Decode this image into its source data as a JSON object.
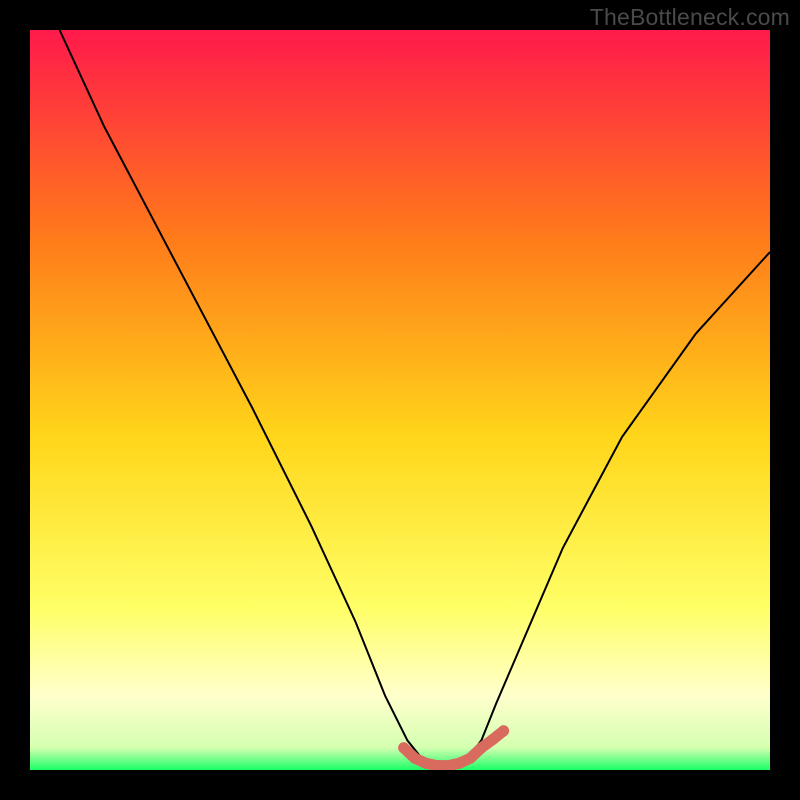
{
  "watermark": "TheBottleneck.com",
  "colors": {
    "frame_bg": "#000000",
    "gradient_top": "#ff1a4b",
    "gradient_mid1": "#ff7a1a",
    "gradient_mid2": "#ffd61a",
    "gradient_low": "#ffff66",
    "gradient_near_bottom": "#ffffcc",
    "gradient_bottom": "#1aff66",
    "curve": "#000000",
    "marker": "#d86a5e"
  },
  "chart_data": {
    "type": "line",
    "title": "",
    "xlabel": "",
    "ylabel": "",
    "xlim": [
      0,
      100
    ],
    "ylim": [
      0,
      100
    ],
    "series": [
      {
        "name": "bottleneck-curve",
        "x": [
          4,
          10,
          20,
          30,
          38,
          44,
          48,
          51,
          53,
          55,
          57,
          59,
          61,
          63,
          66,
          72,
          80,
          90,
          100
        ],
        "y": [
          100,
          87,
          68,
          49,
          33,
          20,
          10,
          4,
          1.5,
          0.8,
          0.8,
          1.5,
          4,
          9,
          16,
          30,
          45,
          59,
          70
        ]
      }
    ],
    "markers": {
      "name": "optimal-range",
      "x": [
        50.5,
        52,
        53.5,
        55,
        56.5,
        58,
        59.5,
        61,
        62.5,
        64
      ],
      "y": [
        3.0,
        1.6,
        0.9,
        0.6,
        0.6,
        0.9,
        1.6,
        3.0,
        4.1,
        5.3
      ]
    },
    "gradient_stops": [
      {
        "offset": 0,
        "color": "#ff1a4b"
      },
      {
        "offset": 28,
        "color": "#ff7a1a"
      },
      {
        "offset": 55,
        "color": "#ffd61a"
      },
      {
        "offset": 78,
        "color": "#ffff66"
      },
      {
        "offset": 90,
        "color": "#ffffcc"
      },
      {
        "offset": 97,
        "color": "#d4ffb0"
      },
      {
        "offset": 100,
        "color": "#1aff66"
      }
    ]
  }
}
